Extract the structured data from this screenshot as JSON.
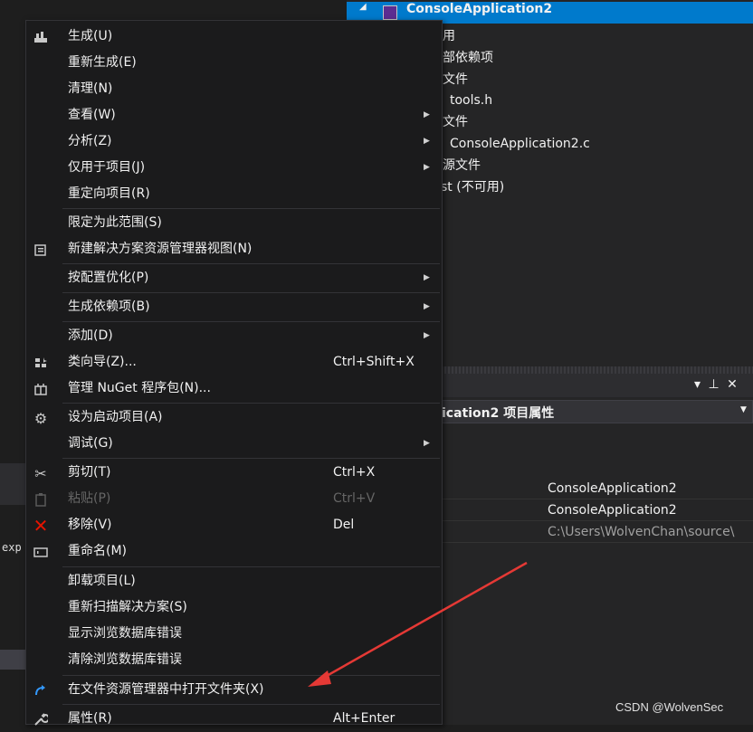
{
  "solution_explorer": {
    "project_name": "ConsoleApplication2",
    "items": [
      {
        "label": "用"
      },
      {
        "label": "部依赖项"
      },
      {
        "label": "文件"
      },
      {
        "label": "tools.h"
      },
      {
        "label": "文件"
      },
      {
        "label": "ConsoleApplication2.c"
      },
      {
        "label": "源文件"
      },
      {
        "label": "st (不可用)"
      }
    ]
  },
  "properties": {
    "title_controls": "▾ ⊥ ✕",
    "combo_label": "ication2 项目属性",
    "rows": [
      {
        "value": "ConsoleApplication2",
        "dim": false
      },
      {
        "value": "ConsoleApplication2",
        "dim": false
      },
      {
        "value": "C:\\Users\\WolvenChan\\source\\",
        "dim": true
      }
    ]
  },
  "editor": {
    "fragment": "exp"
  },
  "context_menu": {
    "items": [
      {
        "label": "生成(U)",
        "shortcut": "",
        "submenu": false,
        "icon": "build-icon",
        "disabled": false
      },
      {
        "label": "重新生成(E)",
        "shortcut": "",
        "submenu": false,
        "icon": "",
        "disabled": false
      },
      {
        "label": "清理(N)",
        "shortcut": "",
        "submenu": false,
        "icon": "",
        "disabled": false
      },
      {
        "label": "查看(W)",
        "shortcut": "",
        "submenu": true,
        "icon": "",
        "disabled": false
      },
      {
        "label": "分析(Z)",
        "shortcut": "",
        "submenu": true,
        "icon": "",
        "disabled": false
      },
      {
        "label": "仅用于项目(J)",
        "shortcut": "",
        "submenu": true,
        "icon": "",
        "disabled": false
      },
      {
        "label": "重定向项目(R)",
        "shortcut": "",
        "submenu": false,
        "icon": "",
        "disabled": false
      },
      {
        "label": "限定为此范围(S)",
        "shortcut": "",
        "submenu": false,
        "icon": "",
        "disabled": false
      },
      {
        "label": "新建解决方案资源管理器视图(N)",
        "shortcut": "",
        "submenu": false,
        "icon": "new-view-icon",
        "disabled": false
      },
      {
        "label": "按配置优化(P)",
        "shortcut": "",
        "submenu": true,
        "icon": "",
        "disabled": false
      },
      {
        "label": "生成依赖项(B)",
        "shortcut": "",
        "submenu": true,
        "icon": "",
        "disabled": false
      },
      {
        "label": "添加(D)",
        "shortcut": "",
        "submenu": true,
        "icon": "",
        "disabled": false
      },
      {
        "label": "类向导(Z)...",
        "shortcut": "Ctrl+Shift+X",
        "submenu": false,
        "icon": "class-wizard-icon",
        "disabled": false
      },
      {
        "label": "管理 NuGet 程序包(N)...",
        "shortcut": "",
        "submenu": false,
        "icon": "nuget-icon",
        "disabled": false
      },
      {
        "label": "设为启动项目(A)",
        "shortcut": "",
        "submenu": false,
        "icon": "gear-icon",
        "disabled": false
      },
      {
        "label": "调试(G)",
        "shortcut": "",
        "submenu": true,
        "icon": "",
        "disabled": false
      },
      {
        "label": "剪切(T)",
        "shortcut": "Ctrl+X",
        "submenu": false,
        "icon": "scissors-icon",
        "disabled": false
      },
      {
        "label": "粘贴(P)",
        "shortcut": "Ctrl+V",
        "submenu": false,
        "icon": "clipboard-icon",
        "disabled": true
      },
      {
        "label": "移除(V)",
        "shortcut": "Del",
        "submenu": false,
        "icon": "remove-icon",
        "disabled": false
      },
      {
        "label": "重命名(M)",
        "shortcut": "",
        "submenu": false,
        "icon": "rename-icon",
        "disabled": false
      },
      {
        "label": "卸载项目(L)",
        "shortcut": "",
        "submenu": false,
        "icon": "",
        "disabled": false
      },
      {
        "label": "重新扫描解决方案(S)",
        "shortcut": "",
        "submenu": false,
        "icon": "",
        "disabled": false
      },
      {
        "label": "显示浏览数据库错误",
        "shortcut": "",
        "submenu": false,
        "icon": "",
        "disabled": false
      },
      {
        "label": "清除浏览数据库错误",
        "shortcut": "",
        "submenu": false,
        "icon": "",
        "disabled": false
      },
      {
        "label": "在文件资源管理器中打开文件夹(X)",
        "shortcut": "",
        "submenu": false,
        "icon": "open-folder-arrow-icon",
        "disabled": false
      },
      {
        "label": "属性(R)",
        "shortcut": "Alt+Enter",
        "submenu": false,
        "icon": "wrench-icon",
        "disabled": false
      }
    ]
  },
  "colors": {
    "selection": "#007acc",
    "arrow": "#e53935",
    "menu_bg": "#1b1b1c"
  },
  "watermark": "CSDN @WolvenSec"
}
